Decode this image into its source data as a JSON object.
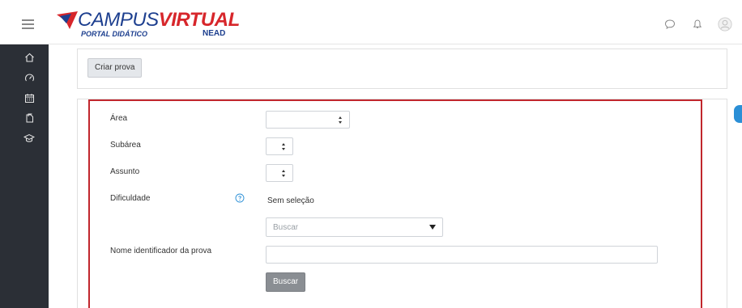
{
  "header": {
    "logo": {
      "main_a": "CAMPUS",
      "main_b": "VIRTUAL",
      "sub": "PORTAL DIDÁTICO",
      "tag": "NEAD"
    },
    "icons": [
      "chat-icon",
      "bell-icon",
      "user-avatar-icon"
    ]
  },
  "drawer": {
    "icons": [
      "home-icon",
      "dashboard-icon",
      "calendar-icon",
      "files-icon",
      "graduation-icon"
    ]
  },
  "top_card": {
    "create_button": "Criar prova"
  },
  "form": {
    "area_label": "Área",
    "subarea_label": "Subárea",
    "assunto_label": "Assunto",
    "dificuldade_label": "Dificuldade",
    "dificuldade_value": "Sem seleção",
    "search_placeholder": "Buscar",
    "nome_label": "Nome identificador da prova",
    "nome_value": "",
    "submit_button": "Buscar"
  },
  "colors": {
    "brand_blue": "#1d3f8f",
    "brand_red": "#d7262b",
    "drawer_bg": "#2b2f36",
    "highlight_frame": "#c1272d",
    "accent_blue": "#2b8fd6"
  }
}
